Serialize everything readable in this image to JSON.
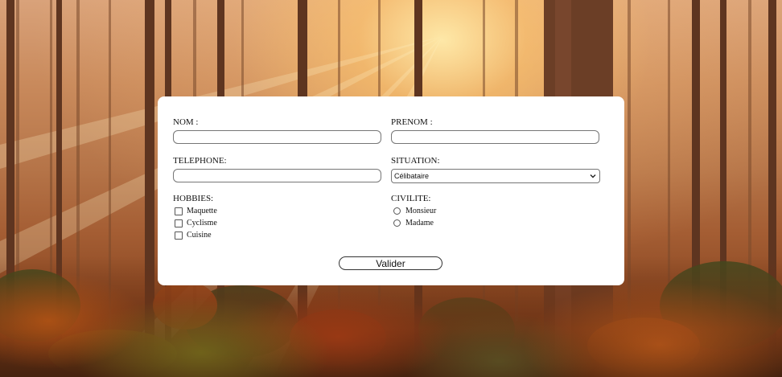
{
  "form": {
    "nom_label": "NOM :",
    "prenom_label": "PRENOM :",
    "telephone_label": "TELEPHONE:",
    "situation_label": "SITUATION:",
    "situation_selected": "Célibataire",
    "hobbies_label": "HOBBIES:",
    "hobbies": [
      "Maquette",
      "Cyclisme",
      "Cuisine"
    ],
    "civilite_label": "CIVILITE:",
    "civilite_options": [
      "Monsieur",
      "Madame"
    ],
    "submit_label": "Valider"
  },
  "colors": {
    "card_background": "#ffffff",
    "input_border": "#767676"
  }
}
